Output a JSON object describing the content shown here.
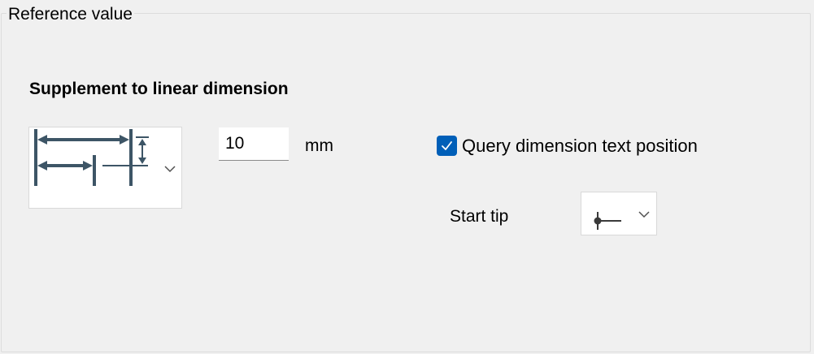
{
  "group": {
    "title": "Reference value"
  },
  "section": {
    "heading": "Supplement to linear dimension"
  },
  "dimension_type": {
    "icon": "linear-dimension-supplement-icon",
    "expand_icon": "chevron-down-icon"
  },
  "offset": {
    "value": "10",
    "unit": "mm"
  },
  "query_text_position": {
    "label": "Query dimension text position",
    "checked": true,
    "accent_color": "#005fb8"
  },
  "start_tip": {
    "label": "Start tip",
    "icon": "dot-tip-icon",
    "expand_icon": "chevron-down-icon"
  },
  "colors": {
    "background": "#f0f0f0",
    "icon_stroke": "#3d5566"
  }
}
